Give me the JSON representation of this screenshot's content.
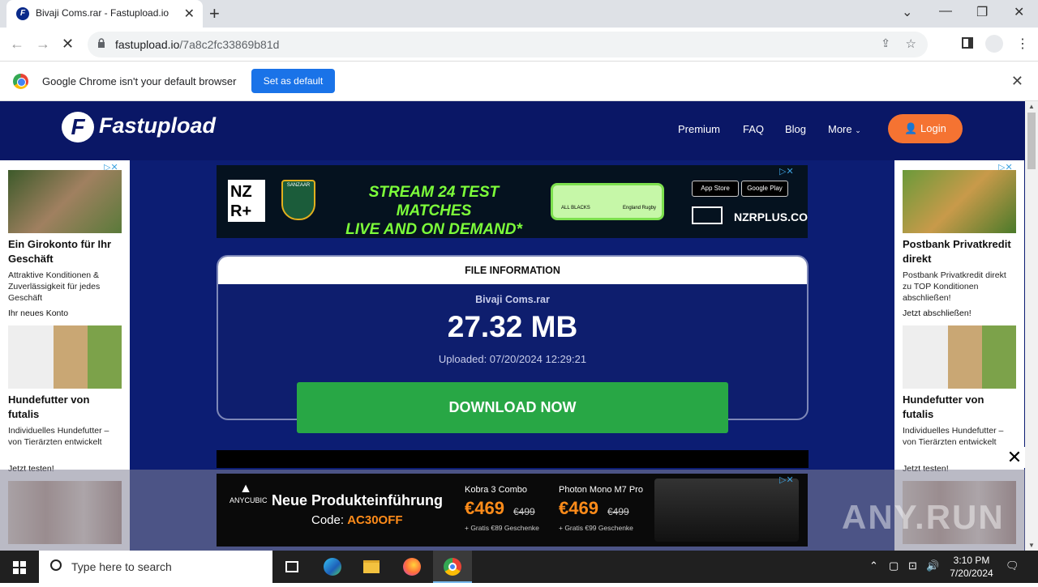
{
  "browser": {
    "tab_title": "Bivaji Coms.rar - Fastupload.io",
    "url_domain": "fastupload.io",
    "url_path": "/7a8c2fc33869b81d",
    "infobar_message": "Google Chrome isn't your default browser",
    "set_default_label": "Set as default"
  },
  "site": {
    "logo": "Fastupload",
    "nav": [
      "Premium",
      "FAQ",
      "Blog",
      "More"
    ],
    "login_label": "Login"
  },
  "left_ad": {
    "h1": "Ein Girokonto für Ihr Geschäft",
    "p1": "Attraktive Konditionen & Zuverlässigkeit für jedes Geschäft",
    "l1": "Ihr neues Konto",
    "h2": "Hundefutter von futalis",
    "p2": "Individuelles Hundefutter – von Tierärzten entwickelt",
    "l2": "Jetzt testen!"
  },
  "right_ad": {
    "h1": "Postbank Privatkredit direkt",
    "p1": "Postbank Privatkredit direkt zu TOP Konditionen abschließen!",
    "l1": "Jetzt abschließen!",
    "h2": "Hundefutter von futalis",
    "p2": "Individuelles Hundefutter – von Tierärzten entwickelt",
    "l2": "Jetzt testen!"
  },
  "top_ad": {
    "brand": "NZ R+",
    "shield_text": "SANZAAR",
    "headline_1": "STREAM 24 TEST MATCHES",
    "headline_2": "LIVE AND ON DEMAND*",
    "team_1": "ALL BLACKS",
    "team_2": "England Rugby",
    "app_store": "App Store",
    "google_play": "Google Play",
    "site": "NZRPLUS.COM"
  },
  "file_info": {
    "header": "FILE INFORMATION",
    "name": "Bivaji Coms.rar",
    "size": "27.32 MB",
    "uploaded": "Uploaded: 07/20/2024 12:29:21",
    "download_label": "DOWNLOAD NOW"
  },
  "bottom_ad": {
    "brand": "ANYCUBIC",
    "headline": "Neue Produkteinführung",
    "code_label": "Code:",
    "code": "AC30OFF",
    "p1_name": "Kobra 3 Combo",
    "p1_price": "€469",
    "p1_old": "€499",
    "p1_gift": "+ Gratis €89 Geschenke",
    "p2_name": "Photon Mono M7 Pro",
    "p2_price": "€469",
    "p2_old": "€499",
    "p2_gift": "+ Gratis €99 Geschenke"
  },
  "watermark": "ANY.RUN",
  "taskbar": {
    "search_placeholder": "Type here to search",
    "time": "3:10 PM",
    "date": "7/20/2024"
  }
}
